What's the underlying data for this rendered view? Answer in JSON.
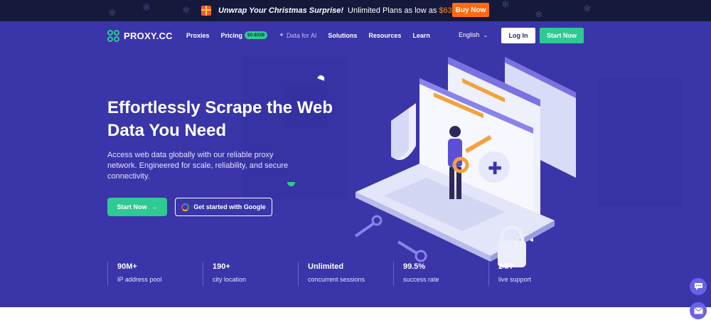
{
  "promo": {
    "title": "Unwrap Your Christmas Surprise!",
    "text": "Unlimited Plans as low as",
    "price": "$63.17/day",
    "button": "Buy Now"
  },
  "nav": {
    "logo": "PROXY.CC",
    "items": [
      "Proxies",
      "Pricing",
      "Data for AI",
      "Solutions",
      "Resources",
      "Learn"
    ],
    "pricing_badge": "$0.8/GB",
    "language": "English",
    "login": "Log In",
    "start": "Start Now"
  },
  "hero": {
    "headline": "Effortlessly Scrape the Web Data You Need",
    "subtext": "Access web data globally with our reliable proxy network. Engineered for scale, reliability, and secure connectivity.",
    "cta_primary": "Start Now",
    "cta_secondary": "Get started with Google"
  },
  "stats": [
    {
      "value": "90M+",
      "label": "IP address pool"
    },
    {
      "value": "190+",
      "label": "city location"
    },
    {
      "value": "Unlimited",
      "label": "concurrent sessions"
    },
    {
      "value": "99.5%",
      "label": "success rate"
    },
    {
      "value": "24/7",
      "label": "live support"
    }
  ],
  "colors": {
    "hero_bg": "#3a35a8",
    "accent_green": "#2fc994",
    "promo_bg": "#151a3d",
    "promo_orange": "#ff6a13"
  },
  "icons": {
    "logo": "proxy-logo-icon",
    "arrow": "arrow-right-icon",
    "google": "google-icon",
    "chat": "chat-icon",
    "mail": "mail-icon"
  }
}
